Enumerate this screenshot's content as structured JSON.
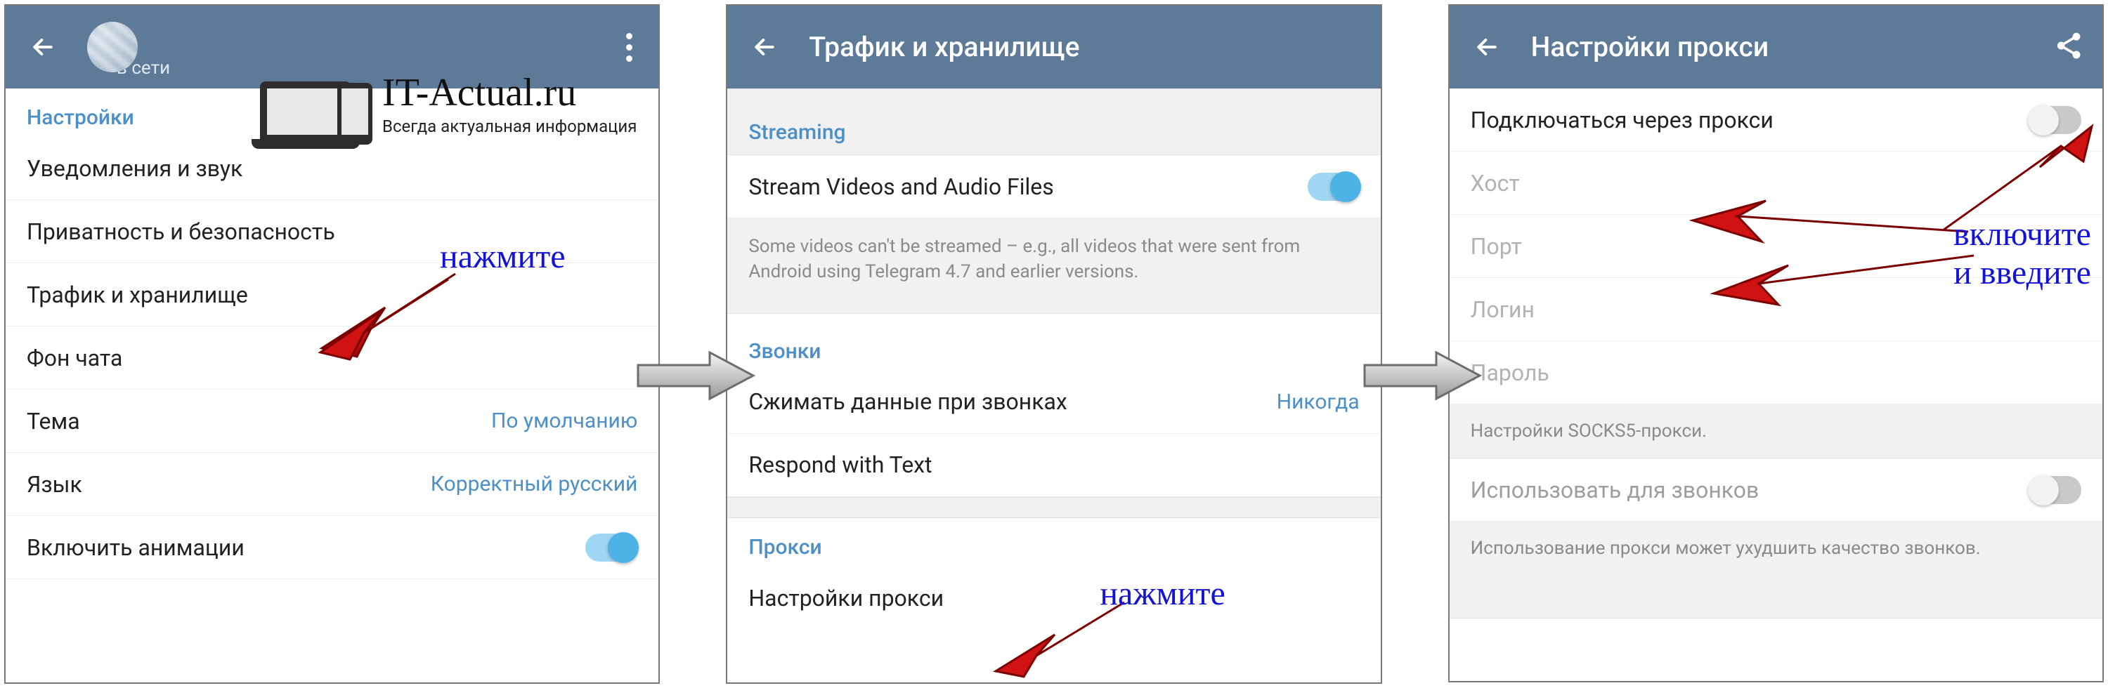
{
  "watermark": {
    "title": "IT-Actual.ru",
    "subtitle": "Всегда актуальная информация"
  },
  "annotations": {
    "press": "нажмите",
    "enable_line1": "включите",
    "enable_line2": "и введите"
  },
  "phone1": {
    "status": "в сети",
    "section": "Настройки",
    "rows": {
      "notifications": "Уведомления и звук",
      "privacy": "Приватность и безопасность",
      "data": "Трафик и хранилище",
      "bg": "Фон чата",
      "theme": "Тема",
      "theme_value": "По умолчанию",
      "lang": "Язык",
      "lang_value": "Корректный русский",
      "anim": "Включить анимации"
    }
  },
  "phone2": {
    "title": "Трафик и хранилище",
    "streaming_header": "Streaming",
    "stream_row": "Stream Videos and Audio Files",
    "stream_hint": "Some videos can't be streamed – e.g., all videos that were sent from Android using Telegram 4.7 and earlier versions.",
    "calls_header": "Звонки",
    "calls_compress": "Сжимать данные при звонках",
    "calls_compress_value": "Никогда",
    "respond": "Respond with Text",
    "proxy_header": "Прокси",
    "proxy_settings": "Настройки прокси"
  },
  "phone3": {
    "title": "Настройки прокси",
    "connect": "Подключаться через прокси",
    "host": "Хост",
    "port": "Порт",
    "login": "Логин",
    "password": "Пароль",
    "socks_hint": "Настройки SOCKS5-прокси.",
    "use_for_calls": "Использовать для звонков",
    "calls_hint": "Использование прокси может ухудшить качество звонков."
  }
}
